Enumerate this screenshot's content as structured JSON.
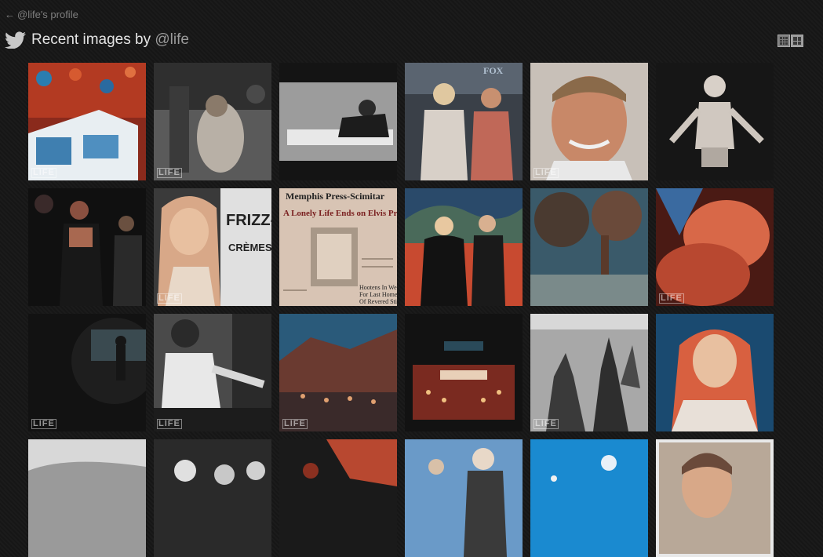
{
  "nav": {
    "back_arrow": "←",
    "back_label": "@life's profile"
  },
  "header": {
    "icon": "twitter-bird-icon",
    "title_prefix": "Recent images by ",
    "handle": "@life"
  },
  "view_toggle": [
    {
      "name": "small-grid-view-button",
      "icon": "small-grid-icon"
    },
    {
      "name": "large-grid-view-button",
      "icon": "large-grid-icon"
    }
  ],
  "watermark": "LIFE",
  "tile_text": {
    "newspaper_masthead": "Memphis Press-Scimitar",
    "newspaper_headline": "A Lonely Life Ends on Elvis Presley",
    "newspaper_sub1": "Hootens In Weld",
    "newspaper_sub2": "For Last Homeland",
    "newspaper_sub3": "Of Revered Sti",
    "sign_text_1": "FRIZZ-",
    "sign_text_2": "CRÈMES",
    "fox_text": "FOX"
  },
  "colors": {
    "background": "#161616",
    "title": "#e4e4e4",
    "link": "#7f7f7f"
  }
}
